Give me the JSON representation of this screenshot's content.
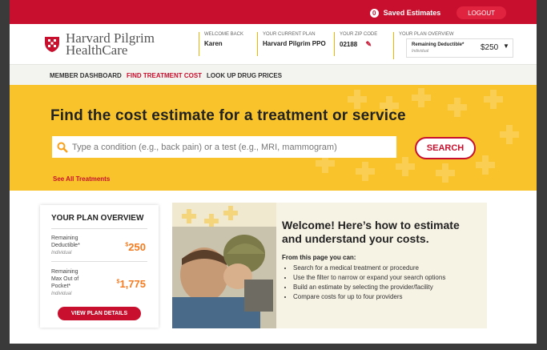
{
  "top_bar": {
    "saved_count": "0",
    "saved_label": "Saved Estimates",
    "logout_label": "LOGOUT"
  },
  "header": {
    "logo_line1": "Harvard Pilgrim",
    "logo_line2": "HealthCare",
    "welcome_label": "WELCOME BACK",
    "welcome_value": "Karen",
    "plan_label": "YOUR CURRENT PLAN",
    "plan_value": "Harvard Pilgrim PPO",
    "zip_label": "YOUR ZIP CODE",
    "zip_value": "02188",
    "overview_label": "YOUR PLAN OVERVIEW",
    "overview_item": "Remaining Deductible*",
    "overview_sub": "Individual",
    "overview_value": "$250"
  },
  "nav": {
    "items": [
      "MEMBER DASHBOARD",
      "FIND TREATMENT COST",
      "LOOK UP DRUG PRICES"
    ],
    "active_index": 1
  },
  "hero": {
    "title": "Find the cost estimate for a treatment or service",
    "search_placeholder": "Type a condition (e.g., back pain) or a test (e.g., MRI, mammogram)",
    "search_button": "SEARCH",
    "see_all": "See All Treatments"
  },
  "plan_card": {
    "title": "YOUR PLAN OVERVIEW",
    "rows": [
      {
        "label1": "Remaining",
        "label2": "Deductible*",
        "label3": "",
        "sub": "Individual",
        "currency": "$",
        "value": "250"
      },
      {
        "label1": "Remaining",
        "label2": "Max Out of",
        "label3": "Pocket*",
        "sub": "Individual",
        "currency": "$",
        "value": "1,775"
      }
    ],
    "button": "VIEW PLAN DETAILS"
  },
  "welcome": {
    "title": "Welcome! Here’s how to estimate and understand your costs.",
    "from_label": "From this page you can:",
    "bullets": [
      "Search for a medical treatment or procedure",
      "Use the filter to narrow or expand your search options",
      "Build an estimate by selecting the provider/facility",
      "Compare costs for up to four providers"
    ]
  },
  "colors": {
    "brand_red": "#c8102e",
    "hero_yellow": "#f9c42b",
    "accent_orange": "#f47b20"
  }
}
